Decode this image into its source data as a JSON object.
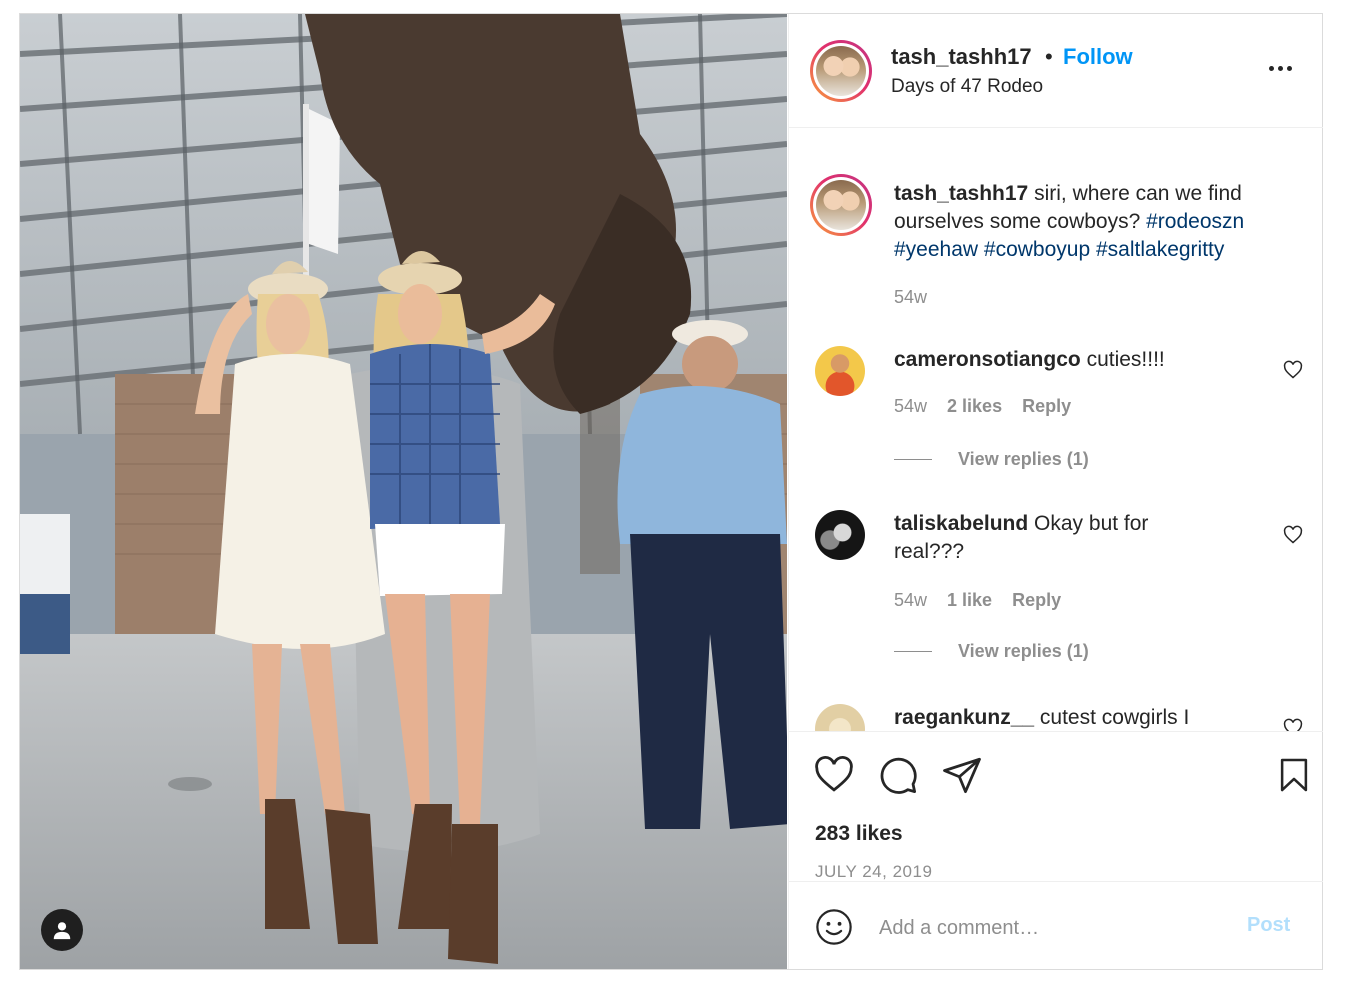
{
  "post": {
    "username": "tash_tashh17",
    "separator": "•",
    "follow_label": "Follow",
    "location": "Days of 47 Rodeo",
    "more_icon": "more-horizontal-icon"
  },
  "caption": {
    "username": "tash_tashh17",
    "text": "siri, where can we find ourselves some cowboys?",
    "hashtags": [
      "#rodeoszn",
      "#yeehaw",
      "#cowboyup",
      "#saltlakegritty"
    ],
    "time": "54w"
  },
  "comments": [
    {
      "username": "cameronsotiangco",
      "text": "cuties!!!!",
      "time": "54w",
      "likes": "2 likes",
      "reply_label": "Reply",
      "view_replies": "View replies (1)"
    },
    {
      "username": "taliskabelund",
      "text": "Okay but for real???",
      "time": "54w",
      "likes": "1 like",
      "reply_label": "Reply",
      "view_replies": "View replies (1)"
    },
    {
      "username": "raegankunz__",
      "text": "cutest cowgirls I"
    }
  ],
  "actions": {
    "like_icon": "heart-icon",
    "comment_icon": "comment-bubble-icon",
    "share_icon": "paper-plane-icon",
    "save_icon": "bookmark-icon"
  },
  "likes_count": "283 likes",
  "date": "JULY 24, 2019",
  "add_comment": {
    "placeholder": "Add a comment…",
    "post_label": "Post"
  },
  "colors": {
    "link_blue": "#0095f6",
    "hashtag": "#00376b",
    "muted": "#8e8e8e",
    "post_disabled": "#b2dffc"
  }
}
